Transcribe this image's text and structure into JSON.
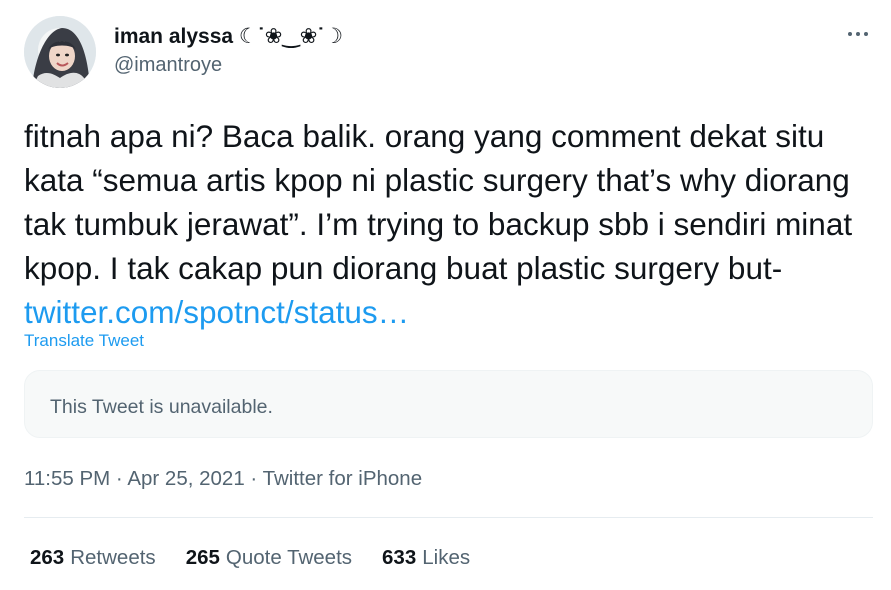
{
  "author": {
    "display_name": "iman alyssa ☾˙❀‿❀˙☽",
    "handle": "@imantroye"
  },
  "tweet": {
    "text": "fitnah apa ni? Baca balik. orang yang comment dekat situ kata “semua artis kpop ni plastic surgery that’s why diorang tak tumbuk jerawat”. I’m trying to backup sbb i sendiri minat kpop. I tak cakap pun diorang buat plastic surgery but- ",
    "link_text": "twitter.com/spotnct/status…",
    "translate_label": "Translate Tweet"
  },
  "quoted": {
    "unavailable_text": "This Tweet is unavailable."
  },
  "meta": {
    "time": "11:55 PM",
    "date": "Apr 25, 2021",
    "source": "Twitter for iPhone",
    "separator": " · "
  },
  "stats": {
    "retweets_count": "263",
    "retweets_label": "Retweets",
    "quotes_count": "265",
    "quotes_label": "Quote Tweets",
    "likes_count": "633",
    "likes_label": "Likes"
  },
  "colors": {
    "link": "#1d9bf0",
    "secondary_text": "#536471",
    "primary_text": "#0f1419"
  },
  "icons": {
    "more": "more-horizontal-icon"
  }
}
